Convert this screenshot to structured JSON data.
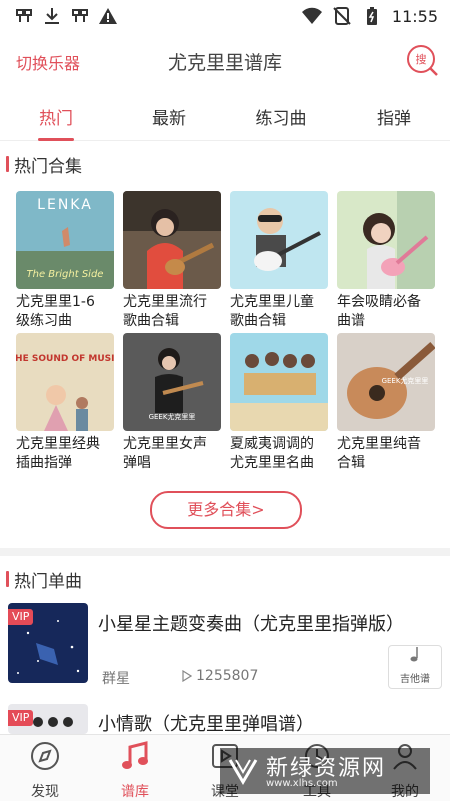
{
  "status_bar": {
    "time": "11:55"
  },
  "header": {
    "switch_label": "切换乐器",
    "title": "尤克里里谱库",
    "search_label": "搜"
  },
  "tabs": [
    {
      "label": "热门"
    },
    {
      "label": "最新"
    },
    {
      "label": "练习曲"
    },
    {
      "label": "指弹"
    }
  ],
  "hot_collections": {
    "title": "热门合集",
    "items": [
      {
        "label": "尤克里里1-6\n级练习曲",
        "cover_text": "LENKA",
        "cover_subtext": "The Bright Side"
      },
      {
        "label": "尤克里里流行\n歌曲合辑"
      },
      {
        "label": "尤克里里儿童\n歌曲合辑"
      },
      {
        "label": "年会吸睛必备\n曲谱"
      },
      {
        "label": "尤克里里经典\n插曲指弹",
        "cover_text": "THE SOUND OF MUSIC"
      },
      {
        "label": "尤克里里女声\n弹唱",
        "cover_text": "GEEK尤克里里"
      },
      {
        "label": "夏威夷调调的\n尤克里里名曲"
      },
      {
        "label": "尤克里里纯音\n合辑",
        "cover_text": "GEEK尤克里里"
      }
    ],
    "more_label": "更多合集>"
  },
  "hot_singles": {
    "title": "热门单曲",
    "items": [
      {
        "title": "小星星主题变奏曲（尤克里里指弹版）",
        "artist": "群星",
        "plays": "1255807",
        "type": "吉他谱",
        "badge": "VIP"
      },
      {
        "title": "小情歌（尤克里里弹唱谱）",
        "badge": "VIP"
      }
    ]
  },
  "bottom_nav": [
    {
      "label": "发现"
    },
    {
      "label": "谱库"
    },
    {
      "label": "课堂"
    },
    {
      "label": "工具"
    },
    {
      "label": "我的"
    }
  ],
  "watermark": {
    "text": "新绿资源网",
    "url": "www.xlhs.com"
  },
  "colors": {
    "accent": "#e0505a"
  }
}
